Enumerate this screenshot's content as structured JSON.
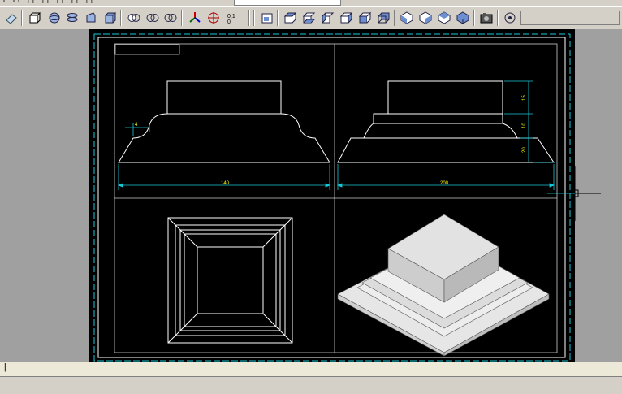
{
  "top_strip": {
    "fragment": "|  ||   ││   ││ ││ ││ ││",
    "field_value": ""
  },
  "toolbar": {
    "tools": [
      {
        "icon": "eraser-icon"
      },
      {
        "icon": "box-select-icon"
      },
      {
        "icon": "solid-globe-icon"
      },
      {
        "icon": "solid-layers-icon"
      },
      {
        "icon": "solid-extrude-icon"
      },
      {
        "icon": "solid-box-icon"
      },
      {
        "icon": "union-icon"
      },
      {
        "icon": "subtract-icon"
      },
      {
        "icon": "intersect-icon"
      },
      {
        "icon": "ucs-axis-icon"
      },
      {
        "icon": "target-icon"
      },
      {
        "icon": "coordinate-icon"
      },
      {
        "icon": "named-views-icon"
      },
      {
        "icon": "top-view-icon"
      },
      {
        "icon": "bottom-view-icon"
      },
      {
        "icon": "left-view-icon"
      },
      {
        "icon": "right-view-icon"
      },
      {
        "icon": "front-view-icon"
      },
      {
        "icon": "back-view-icon"
      },
      {
        "icon": "sw-iso-view-icon"
      },
      {
        "icon": "se-iso-view-icon"
      },
      {
        "icon": "ne-iso-view-icon"
      },
      {
        "icon": "nw-iso-view-icon"
      },
      {
        "icon": "camera-icon"
      },
      {
        "icon": "orbit-icon"
      }
    ]
  },
  "drawing": {
    "dim_left_width": "140",
    "dim_right_width": "200",
    "dim_left_small": "4",
    "dim_heights": [
      "15",
      "10",
      "20"
    ]
  },
  "status": {
    "prompt": "|"
  }
}
